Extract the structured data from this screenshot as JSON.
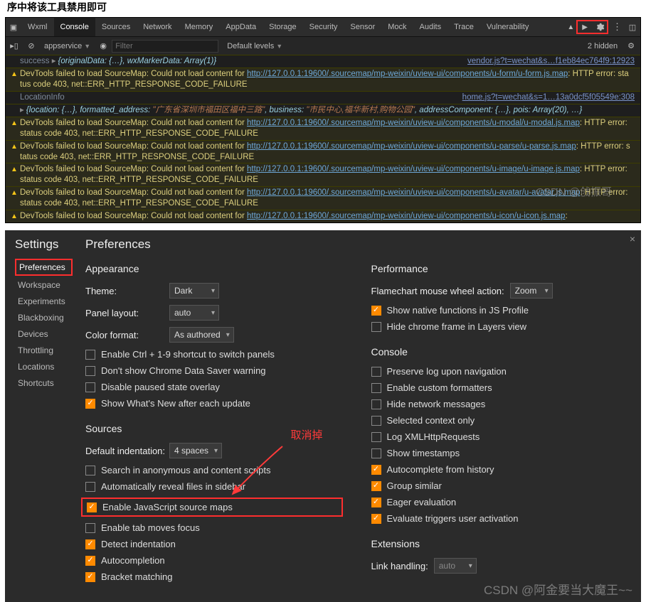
{
  "cropped_header": "序中将该工具禁用即可",
  "devtools": {
    "tabs": [
      "Wxml",
      "Console",
      "Sources",
      "Network",
      "Memory",
      "AppData",
      "Storage",
      "Security",
      "Sensor",
      "Mock",
      "Audits",
      "Trace",
      "Vulnerability"
    ],
    "active_tab": 1,
    "toolbar": {
      "context": "appservice",
      "filter_placeholder": "Filter",
      "levels_label": "Default levels",
      "hidden_count": "2 hidden"
    },
    "logs": [
      {
        "type": "log",
        "content_before": "success",
        "caret": "▸",
        "object": "{originalData: {…}, wxMarkerData: Array(1)}",
        "src": "vendor.js?t=wechat&s…f1eb84ec764f9:12923"
      },
      {
        "type": "warn",
        "content_before": "DevTools failed to load SourceMap: Could not load content for ",
        "link": "http://127.0.0.1:19600/.sourcemap/mp-weixin/uview-ui/components/u-form/u-form.js.map",
        "content_after": ": HTTP error: status code 403, net::ERR_HTTP_RESPONSE_CODE_FAILURE"
      },
      {
        "type": "log",
        "content_before": "LocationInfo",
        "src": "home.js?t=wechat&s=1…13a0dcf5f05549e:308"
      },
      {
        "type": "log",
        "caret": "▸",
        "object_prefix": "{location: {…}, formatted_address: ",
        "string": "\"广东省深圳市福田区福中三路\"",
        "object_mid": ", business: ",
        "string2": "\"市民中心,福华新村,购物公园\"",
        "object_suffix": ", addressComponent: {…}, pois: Array(20), …}"
      },
      {
        "type": "warn",
        "content_before": "DevTools failed to load SourceMap: Could not load content for ",
        "link": "http://127.0.0.1:19600/.sourcemap/mp-weixin/uview-ui/components/u-modal/u-modal.js.map",
        "content_after": ": HTTP error: status code 403, net::ERR_HTTP_RESPONSE_CODE_FAILURE"
      },
      {
        "type": "warn",
        "content_before": "DevTools failed to load SourceMap: Could not load content for ",
        "link": "http://127.0.0.1:19600/.sourcemap/mp-weixin/uview-ui/components/u-parse/u-parse.js.map",
        "content_after": ": HTTP error: status code 403, net::ERR_HTTP_RESPONSE_CODE_FAILURE"
      },
      {
        "type": "warn",
        "content_before": "DevTools failed to load SourceMap: Could not load content for ",
        "link": "http://127.0.0.1:19600/.sourcemap/mp-weixin/uview-ui/components/u-image/u-image.js.map",
        "content_after": ": HTTP error: status code 403, net::ERR_HTTP_RESPONSE_CODE_FAILURE"
      },
      {
        "type": "warn",
        "content_before": "DevTools failed to load SourceMap: Could not load content for ",
        "link": "http://127.0.0.1:19600/.sourcemap/mp-weixin/uview-ui/components/u-avatar/u-avatar.js.map",
        "content_after": ": HTTP error: status code 403, net::ERR_HTTP_RESPONSE_CODE_FAILURE"
      },
      {
        "type": "warn",
        "content_before": "DevTools failed to load SourceMap: Could not load content for ",
        "link": "http://127.0.0.1:19600/.sourcemap/mp-weixin/uview-ui/components/u-icon/u-icon.js.map",
        "content_after": ":"
      }
    ],
    "watermark": "CSDN @戗振哥"
  },
  "settings": {
    "title": "Settings",
    "main_title": "Preferences",
    "close": "×",
    "sidebar": [
      "Preferences",
      "Workspace",
      "Experiments",
      "Blackboxing",
      "Devices",
      "Throttling",
      "Locations",
      "Shortcuts"
    ],
    "appearance": {
      "heading": "Appearance",
      "theme_label": "Theme:",
      "theme_value": "Dark",
      "panel_label": "Panel layout:",
      "panel_value": "auto",
      "color_label": "Color format:",
      "color_value": "As authored",
      "cb1": "Enable Ctrl + 1-9 shortcut to switch panels",
      "cb2": "Don't show Chrome Data Saver warning",
      "cb3": "Disable paused state overlay",
      "cb4": "Show What's New after each update"
    },
    "sources": {
      "heading": "Sources",
      "indent_label": "Default indentation:",
      "indent_value": "4 spaces",
      "cb1": "Search in anonymous and content scripts",
      "cb2": "Automatically reveal files in sidebar",
      "cb3": "Enable JavaScript source maps",
      "cb4": "Enable tab moves focus",
      "cb5": "Detect indentation",
      "cb6": "Autocompletion",
      "cb7": "Bracket matching",
      "annotation": "取消掉"
    },
    "performance": {
      "heading": "Performance",
      "wheel_label": "Flamechart mouse wheel action:",
      "wheel_value": "Zoom",
      "cb1": "Show native functions in JS Profile",
      "cb2": "Hide chrome frame in Layers view"
    },
    "console": {
      "heading": "Console",
      "items": [
        {
          "label": "Preserve log upon navigation",
          "on": false
        },
        {
          "label": "Enable custom formatters",
          "on": false
        },
        {
          "label": "Hide network messages",
          "on": false
        },
        {
          "label": "Selected context only",
          "on": false
        },
        {
          "label": "Log XMLHttpRequests",
          "on": false
        },
        {
          "label": "Show timestamps",
          "on": false
        },
        {
          "label": "Autocomplete from history",
          "on": true
        },
        {
          "label": "Group similar",
          "on": true
        },
        {
          "label": "Eager evaluation",
          "on": true
        },
        {
          "label": "Evaluate triggers user activation",
          "on": true
        }
      ]
    },
    "extensions": {
      "heading": "Extensions",
      "link_label": "Link handling:",
      "link_value": "auto"
    },
    "watermark": "CSDN @阿金要当大魔王~~"
  }
}
